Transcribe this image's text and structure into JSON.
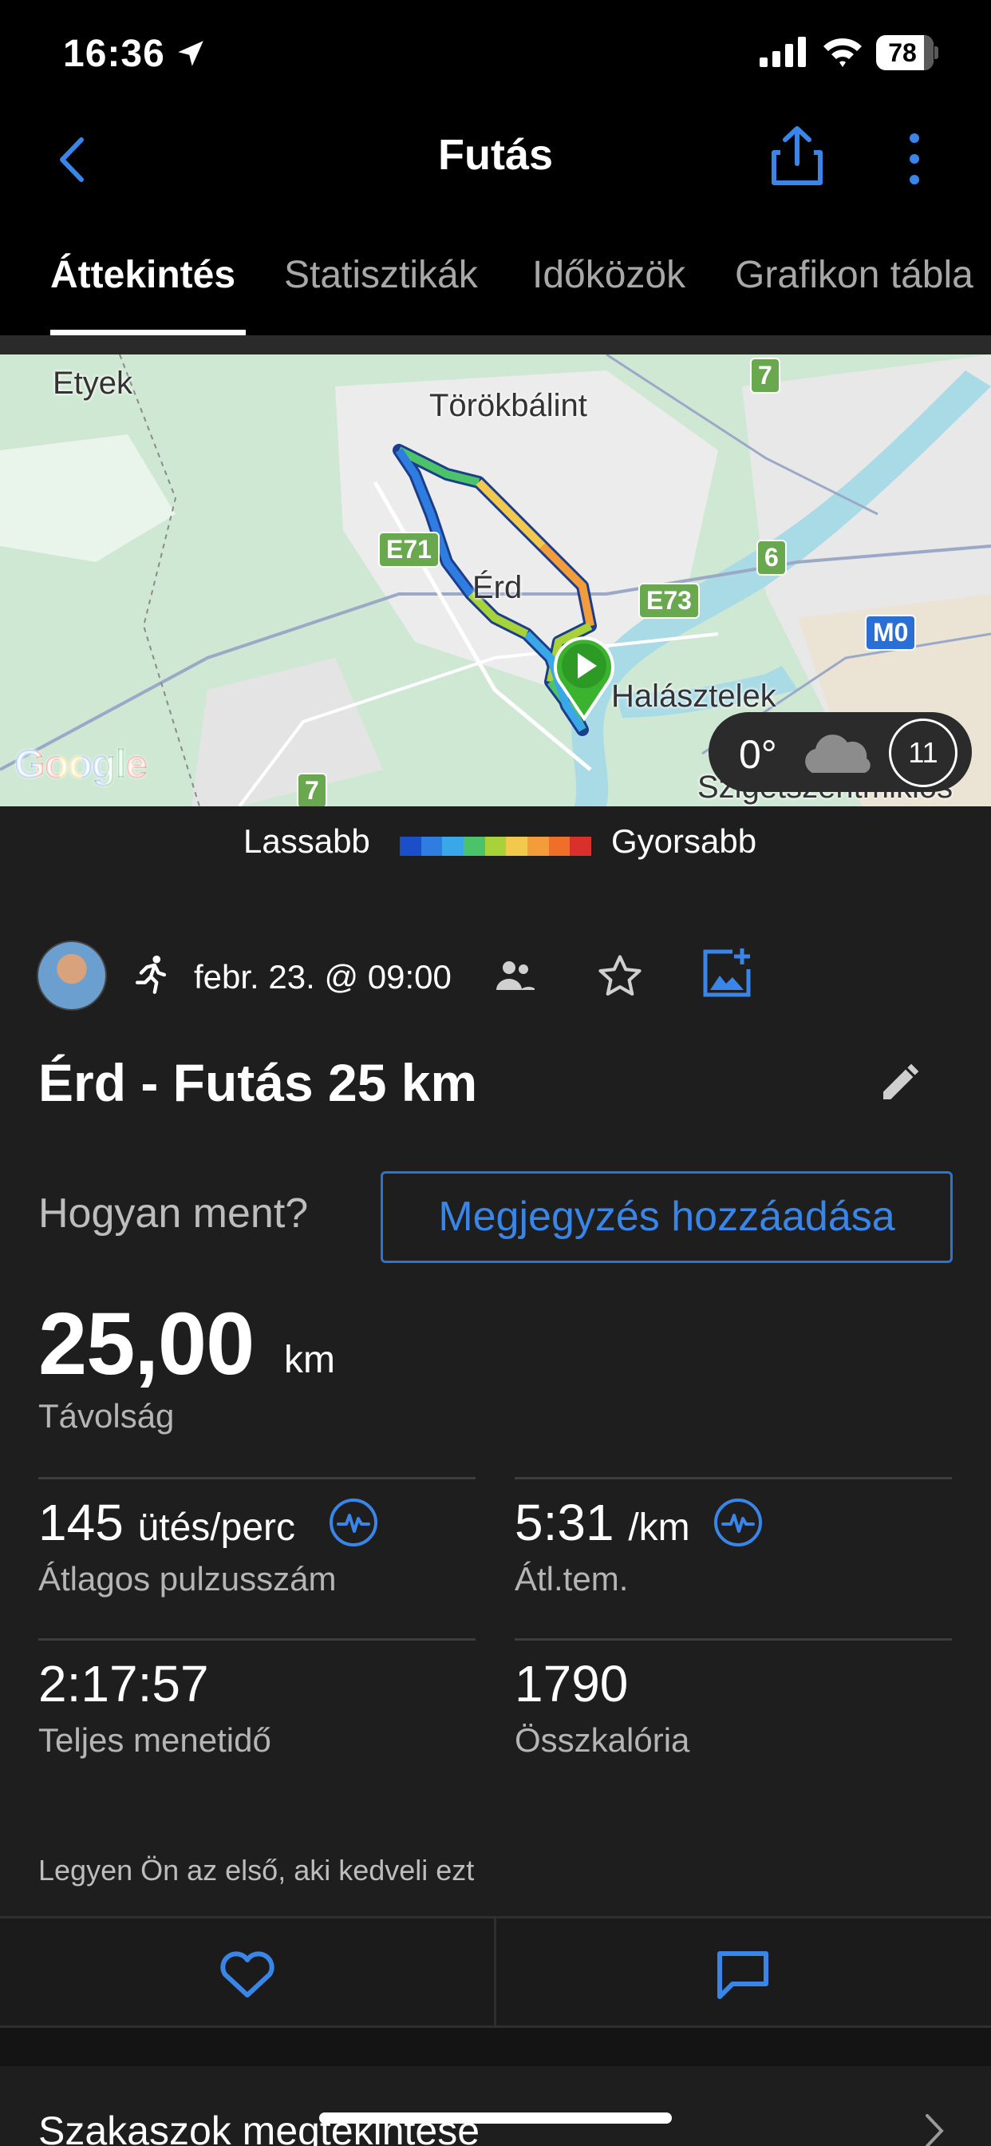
{
  "status_bar": {
    "time": "16:36",
    "battery": "78"
  },
  "nav": {
    "title": "Futás"
  },
  "tabs": [
    {
      "label": "Áttekintés",
      "active": true
    },
    {
      "label": "Statisztikák",
      "active": false
    },
    {
      "label": "Időközök",
      "active": false
    },
    {
      "label": "Grafikon tábla",
      "active": false
    }
  ],
  "map": {
    "places": [
      "Etyek",
      "Törökbálint",
      "Érd",
      "Halásztelek",
      "Szigetszentmiklós"
    ],
    "road_shields": [
      "E71",
      "E73",
      "7",
      "6",
      "7",
      "M0"
    ],
    "attribution": "Google",
    "weather": {
      "temp": "0°",
      "wind": "11",
      "condition_icon": "cloud-icon"
    }
  },
  "pace_legend": {
    "slow": "Lassabb",
    "fast": "Gyorsabb",
    "colors": [
      "#1a4fc9",
      "#2f7de0",
      "#3aa7e8",
      "#4cc36a",
      "#a7d23a",
      "#f2c94c",
      "#f39c3c",
      "#ee6f2a",
      "#d9302b"
    ]
  },
  "activity": {
    "date": "febr. 23. @ 09:00",
    "title": "Érd - Futás 25 km",
    "feel_prompt": "Hogyan ment?",
    "note_button": "Megjegyzés hozzáadása"
  },
  "stats": {
    "distance": {
      "value": "25,00",
      "unit": "km",
      "label": "Távolság"
    },
    "avg_hr": {
      "value": "145",
      "unit": "ütés/perc",
      "label": "Átlagos pulzusszám"
    },
    "avg_pace": {
      "value": "5:31",
      "unit": "/km",
      "label": "Átl.tem."
    },
    "total_time": {
      "value": "2:17:57",
      "label": "Teljes menetidő"
    },
    "calories": {
      "value": "1790",
      "label": "Összkalória"
    }
  },
  "social": {
    "like_prompt": "Legyen Ön az első, aki kedveli ezt"
  },
  "segments": {
    "label": "Szakaszok megtekintése"
  }
}
